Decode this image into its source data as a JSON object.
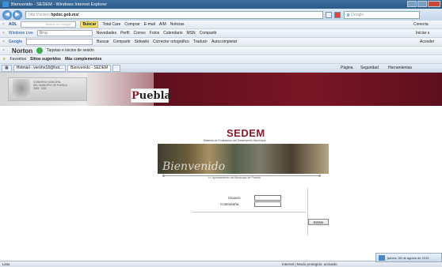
{
  "window": {
    "title": "Bienvenido - SEDEM - Windows Internet Explorer"
  },
  "address": {
    "url_prefix": "http://sistem.",
    "url_host": "hpdsc.gob.mx/",
    "search_placeholder": "Google"
  },
  "toolbar1": {
    "aol": "AOL",
    "search_label": "Buscar en Google",
    "buscar": "Buscar",
    "items": [
      "Total Care",
      "Comprar",
      "E-mail",
      "AIM",
      "Noticias"
    ],
    "right": "Conecta"
  },
  "toolbar2": {
    "windows_live": "Windows Live",
    "bing": "Bing",
    "items": [
      "Novedades",
      "Perfil",
      "Correo",
      "Fotos",
      "Calendario",
      "MSN",
      "Compartir"
    ],
    "right": "Iniciar s"
  },
  "toolbar3": {
    "google": "Google",
    "buscar": "Buscar",
    "items": [
      "Compartir",
      "Sidewiki",
      "Corrector ortográfico",
      "Traducir",
      "Autocompletar"
    ],
    "right": "Acceder"
  },
  "toolbar4": {
    "norton": "Norton",
    "tarjetas": "Tarjetas e inicios de sesión"
  },
  "toolbar5": {
    "favoritos": "Favoritos",
    "sitios": "Sitios sugeridos",
    "mas": "Más complementos"
  },
  "tabs": {
    "items": [
      "Hotmail - verohn18@hot...",
      "Bienvenido - SEDEM"
    ],
    "right_items": [
      "Página",
      "Seguridad",
      "Herramientas"
    ]
  },
  "header": {
    "seal_lines": [
      "GOBIERNO MUNICIPAL",
      "DEL MUNICIPIO DE PUEBLA",
      "2008 · 2011"
    ],
    "puebla_p": "P",
    "puebla_rest": "uebla"
  },
  "page": {
    "brand": "SEDEM",
    "subtitle": "Sistema de Evaluación del Desempeño Municipal",
    "banner_word": "Bienvenido",
    "ayuntamiento": "H. Ayuntamiento del Municipio de Puebla",
    "usuario_label": "Usuario",
    "contrasena_label": "Contraseña",
    "enter_label": "Entrar"
  },
  "status": {
    "left": "Listo",
    "right": "Internet | Modo protegido: activado",
    "date": "jueves, 05 de agosto de 2010"
  },
  "colors": {
    "brand": "#8a1b2c",
    "banner": "#7a1626"
  }
}
